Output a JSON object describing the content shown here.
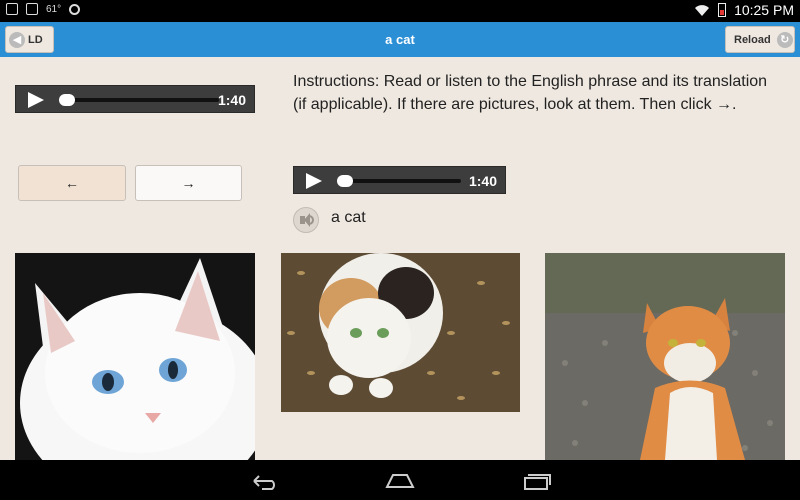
{
  "status_bar": {
    "temperature": "61°",
    "time": "10:25 PM",
    "icons": [
      "tablet-icon",
      "image-icon",
      "settings-icon",
      "wifi-icon",
      "battery-icon"
    ]
  },
  "app_bar": {
    "back_label": "LD",
    "title": "a cat",
    "reload_label": "Reload"
  },
  "players": {
    "left": {
      "time": "1:40",
      "progress": 0.0
    },
    "right": {
      "time": "1:40",
      "progress": 0.0
    }
  },
  "nav": {
    "prev_label": "←",
    "next_label": "→"
  },
  "instructions": "Instructions: Read or listen to the English phrase and its translation (if applicable). If there are pictures, look at them. Then click →.",
  "phrase": "a cat",
  "images": [
    {
      "name": "white-cat-image",
      "subject": "white cat"
    },
    {
      "name": "calico-cat-image",
      "subject": "calico cat"
    },
    {
      "name": "orange-white-cat-image",
      "subject": "orange and white cat"
    }
  ],
  "system_nav": [
    "back-icon",
    "home-icon",
    "recent-apps-icon"
  ]
}
